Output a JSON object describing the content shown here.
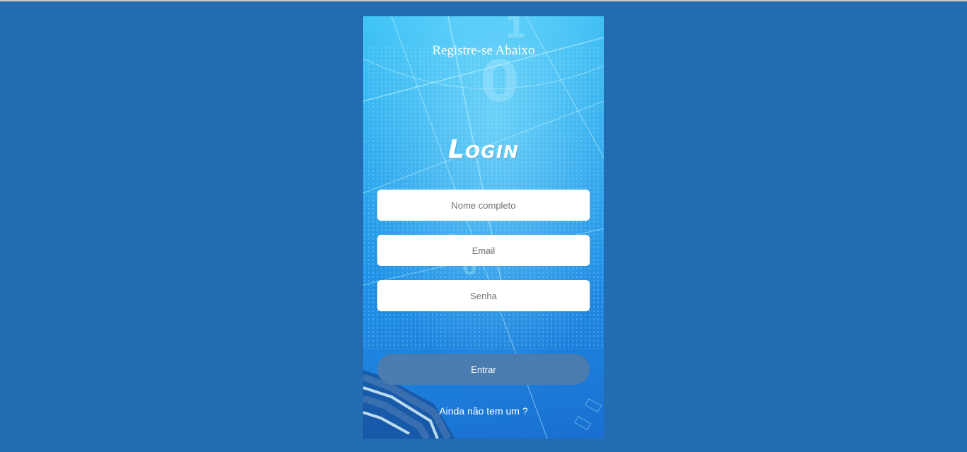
{
  "form": {
    "header": "Registre-se Abaixo",
    "title": "Login",
    "fields": {
      "name_placeholder": "Nome completo",
      "email_placeholder": "Email",
      "password_placeholder": "Senha"
    },
    "submit_label": "Entrar",
    "signup_link": "Ainda não tem um ?"
  },
  "colors": {
    "page_background": "#246cb2",
    "button": "#4a7cb0"
  }
}
